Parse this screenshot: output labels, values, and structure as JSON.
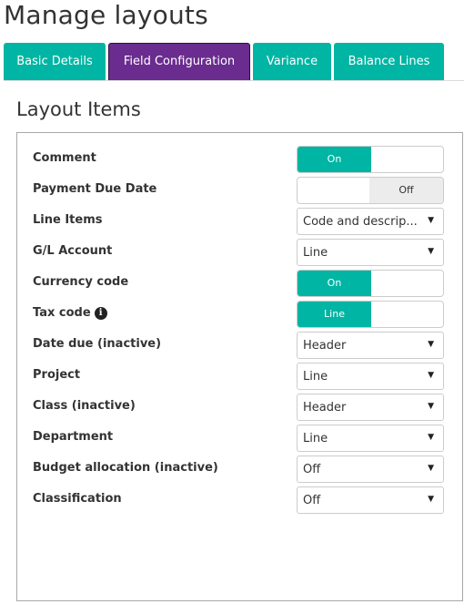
{
  "page": {
    "title": "Manage layouts"
  },
  "tabs": [
    {
      "label": "Basic Details",
      "active": false
    },
    {
      "label": "Field Configuration",
      "active": true
    },
    {
      "label": "Variance",
      "active": false
    },
    {
      "label": "Balance Lines",
      "active": false
    }
  ],
  "section": {
    "title": "Layout Items"
  },
  "items": [
    {
      "label": "Comment",
      "control": "toggle",
      "value": "On",
      "state": "on"
    },
    {
      "label": "Payment Due Date",
      "control": "toggle",
      "value": "Off",
      "state": "off"
    },
    {
      "label": "Line Items",
      "control": "select",
      "value": "Code and descrip..."
    },
    {
      "label": "G/L Account",
      "control": "select",
      "value": "Line"
    },
    {
      "label": "Currency code",
      "control": "toggle",
      "value": "On",
      "state": "on"
    },
    {
      "label": "Tax code",
      "control": "toggle",
      "value": "Line",
      "state": "on",
      "info_icon": true
    },
    {
      "label": "Date due (inactive)",
      "control": "select",
      "value": "Header"
    },
    {
      "label": "Project",
      "control": "select",
      "value": "Line"
    },
    {
      "label": "Class (inactive)",
      "control": "select",
      "value": "Header"
    },
    {
      "label": "Department",
      "control": "select",
      "value": "Line"
    },
    {
      "label": "Budget allocation (inactive)",
      "control": "select",
      "value": "Off"
    },
    {
      "label": "Classification",
      "control": "select",
      "value": "Off"
    }
  ],
  "icons": {
    "info": "info-icon",
    "dropdown": "chevron-down-icon"
  },
  "colors": {
    "accent": "#00b5a3",
    "active_tab": "#6a2c8f",
    "off_segment": "#ececec"
  }
}
